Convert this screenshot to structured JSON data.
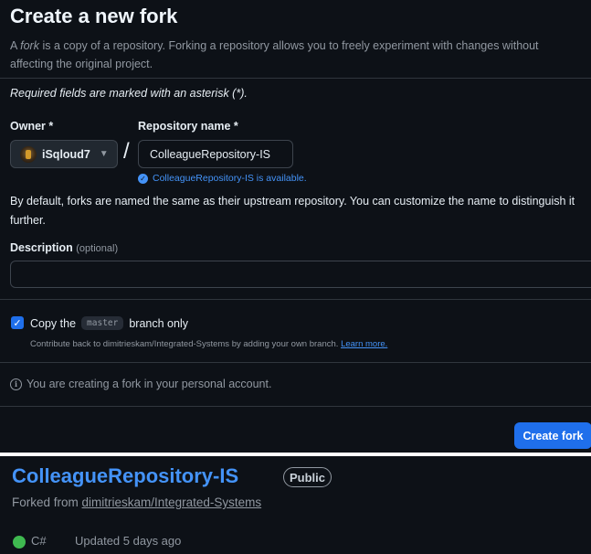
{
  "form": {
    "title": "Create a new fork",
    "intro_prefix": "A ",
    "intro_em": "fork",
    "intro_rest": " is a copy of a repository. Forking a repository allows you to freely experiment with changes without affecting the original project.",
    "required_note": "Required fields are marked with an asterisk (*).",
    "owner_label": "Owner *",
    "owner_value": "iSqloud7",
    "repo_label": "Repository name *",
    "repo_value": "ColleagueRepository-IS",
    "availability": "ColleagueRepository-IS is available.",
    "default_note": "By default, forks are named the same as their upstream repository. You can customize the name to distinguish it further.",
    "description_label": "Description",
    "description_optional": "(optional)",
    "description_value": "",
    "copy_prefix": "Copy the",
    "copy_branch": "master",
    "copy_suffix": "branch only",
    "copy_checked": true,
    "contrib_text": "Contribute back to dimitrieskam/Integrated-Systems by adding your own branch.",
    "learn_more": "Learn more.",
    "info_text": "You are creating a fork in your personal account.",
    "create_button": "Create fork"
  },
  "repo_card": {
    "name": "ColleagueRepository-IS",
    "visibility": "Public",
    "forked_prefix": "Forked from",
    "forked_from": "dimitrieskam/Integrated-Systems",
    "language": "C#",
    "language_color": "#3fb950",
    "updated": "Updated 5 days ago"
  },
  "colors": {
    "background": "#0d1117",
    "accent": "#1f6feb",
    "link": "#4493f8"
  }
}
